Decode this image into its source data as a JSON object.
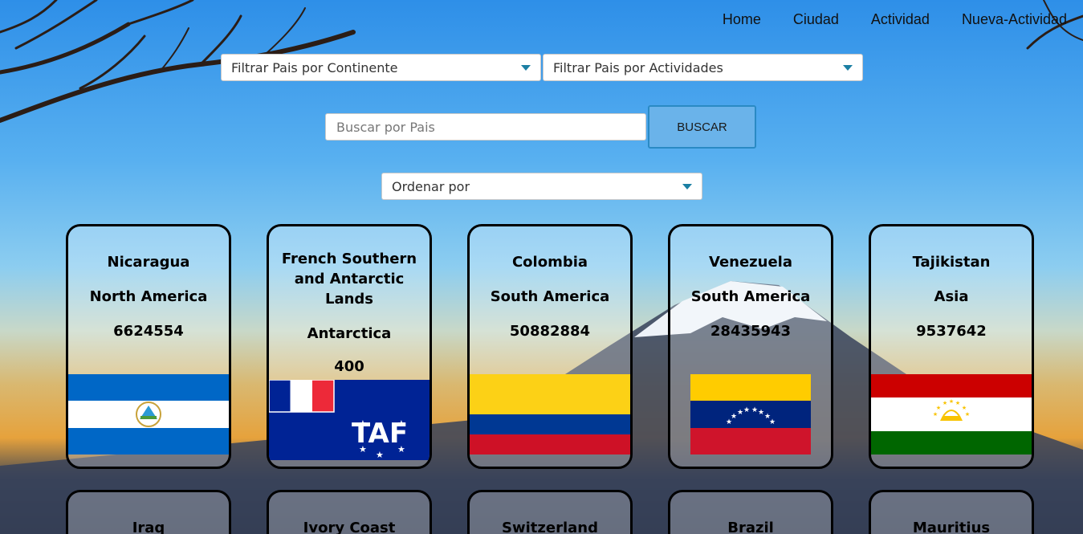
{
  "nav": {
    "items": [
      "Home",
      "Ciudad",
      "Actividad",
      "Nueva-Actividad"
    ]
  },
  "filters": {
    "continent_placeholder": "Filtrar Pais por Continente",
    "activity_placeholder": "Filtrar Pais por Actividades",
    "order_placeholder": "Ordenar por"
  },
  "search": {
    "placeholder": "Buscar por Pais",
    "button_label": "BUSCAR"
  },
  "cards": [
    {
      "name": "Nicaragua",
      "continent": "North America",
      "population": "6624554",
      "flag": "nicaragua-flag"
    },
    {
      "name": "French Southern and Antarctic Lands",
      "continent": "Antarctica",
      "population": "400",
      "flag": "french-southern-flag"
    },
    {
      "name": "Colombia",
      "continent": "South America",
      "population": "50882884",
      "flag": "colombia-flag"
    },
    {
      "name": "Venezuela",
      "continent": "South America",
      "population": "28435943",
      "flag": "venezuela-flag"
    },
    {
      "name": "Tajikistan",
      "continent": "Asia",
      "population": "9537642",
      "flag": "tajikistan-flag"
    },
    {
      "name": "Iraq"
    },
    {
      "name": "Ivory Coast"
    },
    {
      "name": "Switzerland"
    },
    {
      "name": "Brazil"
    },
    {
      "name": "Mauritius"
    }
  ],
  "colors": {
    "sky_top": "#2e8fe8",
    "button_bg": "#6ab3ea",
    "caret": "#1b7fa3"
  }
}
